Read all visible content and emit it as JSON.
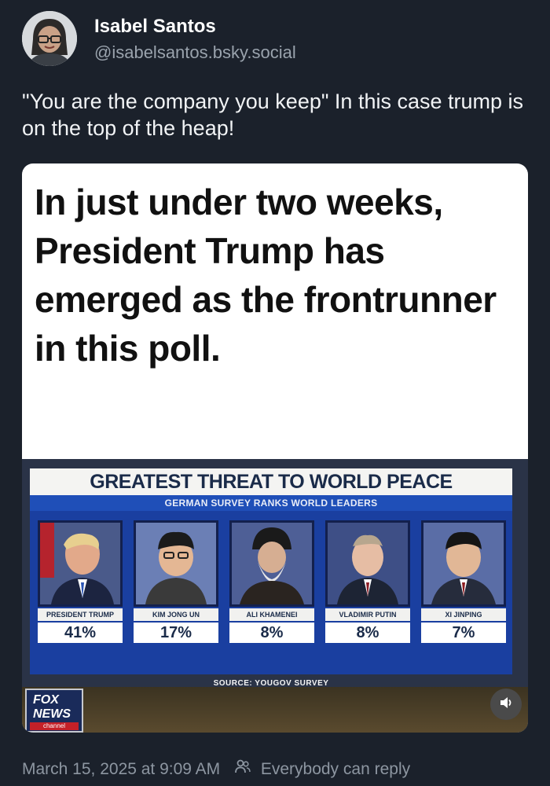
{
  "author": {
    "display_name": "Isabel Santos",
    "handle": "@isabelsantos.bsky.social"
  },
  "post": {
    "text": "\"You are the company you keep\" In this case trump is on the top of the heap!",
    "timestamp": "March 15, 2025 at 9:09 AM",
    "reply_setting": "Everybody can reply"
  },
  "embed": {
    "headline": "In just under two weeks, President Trump has emerged as the frontrunner in this poll.",
    "tv": {
      "title": "GREATEST THREAT TO WORLD PEACE",
      "subtitle": "GERMAN SURVEY RANKS WORLD LEADERS",
      "leaders": [
        {
          "name": "PRESIDENT TRUMP",
          "percent": "41%"
        },
        {
          "name": "KIM JONG UN",
          "percent": "17%"
        },
        {
          "name": "ALI KHAMENEI",
          "percent": "8%"
        },
        {
          "name": "VLADIMIR PUTIN",
          "percent": "8%"
        },
        {
          "name": "XI JINPING",
          "percent": "7%"
        }
      ],
      "source": "SOURCE: YOUGOV SURVEY",
      "logo": {
        "line1": "FOX",
        "line2": "NEWS",
        "line3": "channel"
      }
    }
  },
  "icons": {
    "sound": "speaker-icon",
    "reply_audience": "people-icon"
  }
}
